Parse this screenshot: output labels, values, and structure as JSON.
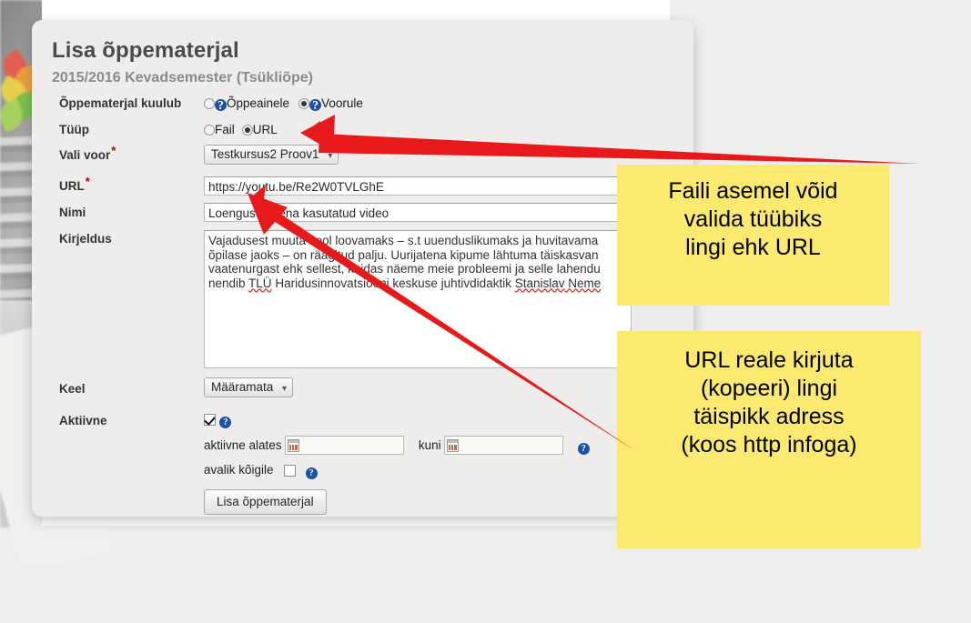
{
  "dialog": {
    "title": "Lisa õppematerjal",
    "subtitle": "2015/2016 Kevadsemester (Tsükliõpe)"
  },
  "form": {
    "belongs_to": {
      "label": "Õppematerjal kuulub",
      "options": [
        {
          "label": "Õppeainele",
          "selected": false,
          "help": "?"
        },
        {
          "label": "Voorule",
          "selected": true,
          "help": "?"
        }
      ]
    },
    "type": {
      "label": "Tüüp",
      "options": [
        {
          "label": "Fail",
          "selected": false
        },
        {
          "label": "URL",
          "selected": true
        }
      ]
    },
    "round": {
      "label": "Vali voor",
      "required": "*",
      "value": "Testkursus2 Proov1",
      "caret": "chevron-down-icon"
    },
    "url": {
      "label": "URL",
      "required": "*",
      "value": "https://youtu.be/Re2W0TVLGhE"
    },
    "name": {
      "label": "Nimi",
      "value": "Loengus näitena kasutatud video"
    },
    "description": {
      "label": "Kirjeldus",
      "line1_a": "Vajadusest muuta kool loovamaks – s.t uuenduslikumaks ja huvitavama",
      "line2_a": "õpilase jaoks – on räägitud palju. Uurijatena kipume lähtuma täiskasvan",
      "line3_a": "vaatenurgast ehk sellest, kuidas näeme meie probleemi ja selle lahendu",
      "line4_a": "nendib ",
      "line4_b": "TLÜ",
      "line4_c": " Haridusinnovatsiooni keskuse juhtivdidaktik ",
      "line4_d": "Stanislav",
      "line4_e": " Neme"
    },
    "language": {
      "label": "Keel",
      "value": "Määramata",
      "caret": "chevron-down-icon"
    },
    "active": {
      "label": "Aktiivne",
      "checked": true,
      "help": "?",
      "from_label": "aktiivne alates",
      "from_value": "",
      "until_label": "kuni",
      "until_value": "",
      "date_help": "?",
      "public_label": "avalik kõigile",
      "public_checked": false,
      "public_help": "?"
    },
    "submit_label": "Lisa õppematerjal"
  },
  "annotations": {
    "note_top": {
      "line1": "Faili asemel võid",
      "line2": "valida tüübiks",
      "line3": "lingi ehk URL"
    },
    "note_bottom": {
      "line1": "URL reale kirjuta",
      "line2": "(kopeeri) lingi",
      "line3": "täispikk adress",
      "line4": "(koos http infoga)"
    },
    "arrow_color": "#e8191b"
  },
  "colors": {
    "note_bg": "#fce96f",
    "panel_bg": "#eeedeb",
    "title": "#4a4a4a",
    "subtitle": "#8b8b8b",
    "help_blue": "#1b52a8",
    "required_red": "#b00000"
  }
}
